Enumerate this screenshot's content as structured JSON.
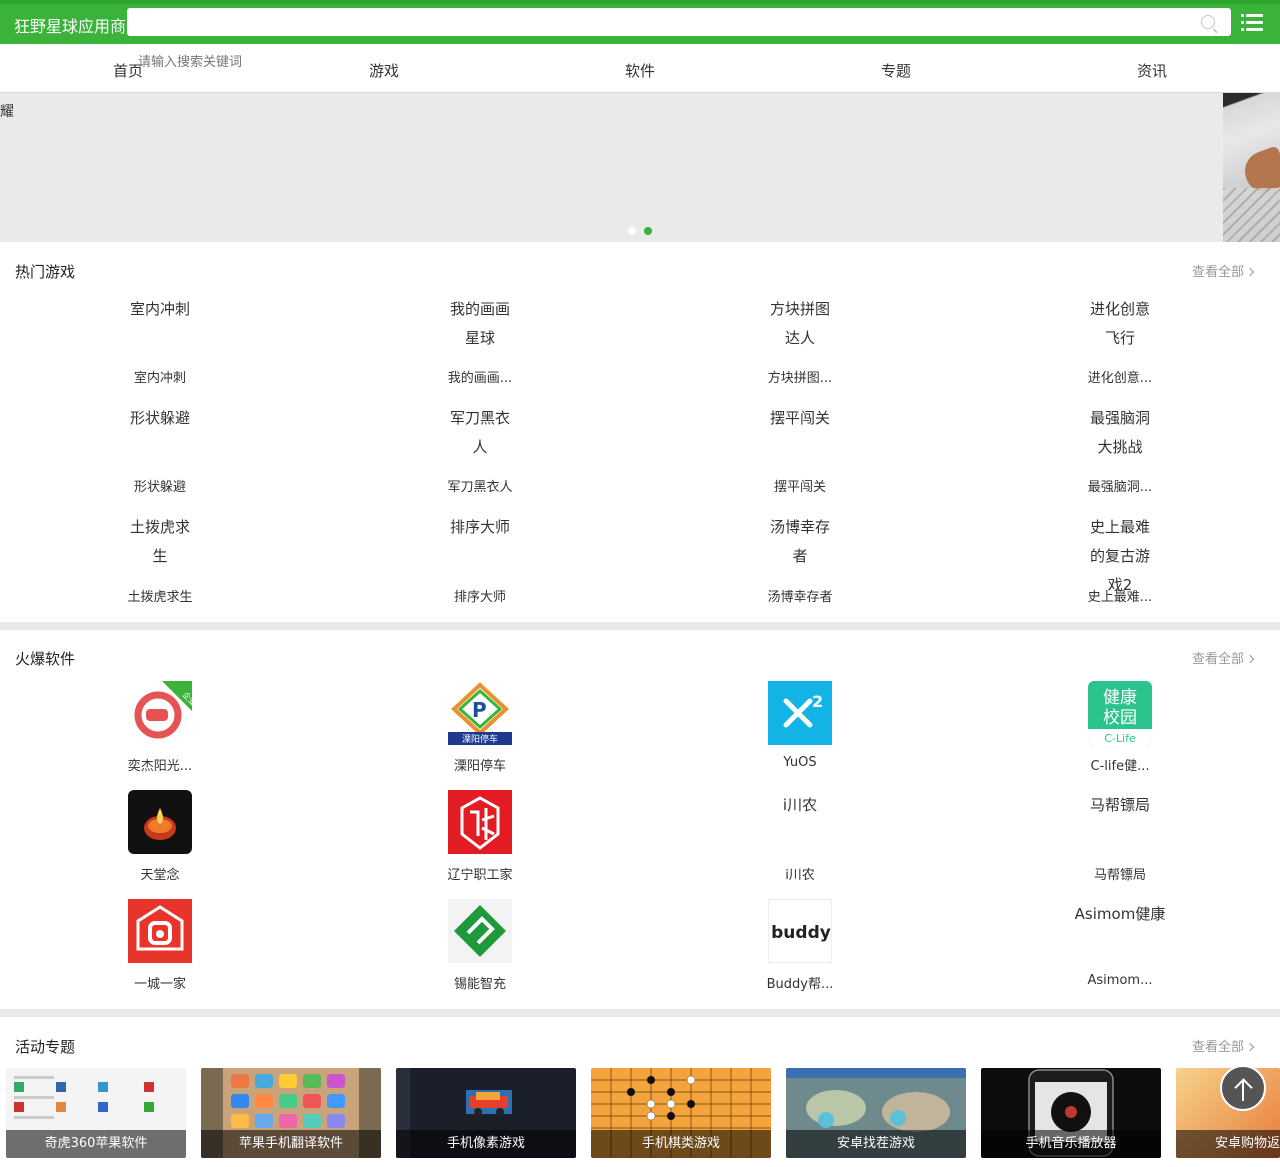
{
  "header": {
    "site_name": "狂野星球应用商",
    "search_placeholder": "请输入搜索关键词"
  },
  "nav": {
    "items": [
      "首页",
      "游戏",
      "软件",
      "专题",
      "资讯"
    ]
  },
  "banner": {
    "left_glyph": "耀",
    "active_dot": 2,
    "dot_count": 2
  },
  "hot_games": {
    "title": "热门游戏",
    "view_all": "查看全部",
    "items": [
      {
        "icon_alt": "室内冲刺",
        "name": "室内冲刺"
      },
      {
        "icon_alt": "我的画画星球",
        "name": "我的画画..."
      },
      {
        "icon_alt": "方块拼图达人",
        "name": "方块拼图..."
      },
      {
        "icon_alt": "进化创意飞行",
        "name": "进化创意..."
      },
      {
        "icon_alt": "形状躲避",
        "name": "形状躲避"
      },
      {
        "icon_alt": "军刀黑衣人",
        "name": "军刀黑衣人"
      },
      {
        "icon_alt": "摆平闯关",
        "name": "摆平闯关"
      },
      {
        "icon_alt": "最强脑洞大挑战",
        "name": "最强脑洞..."
      },
      {
        "icon_alt": "土拨虎求生",
        "name": "土拨虎求生"
      },
      {
        "icon_alt": "排序大师",
        "name": "排序大师"
      },
      {
        "icon_alt": "汤博幸存者",
        "name": "汤博幸存者"
      },
      {
        "icon_alt": "史上最难的复古游戏2",
        "name": "史上最难..."
      }
    ]
  },
  "hot_software": {
    "title": "火爆软件",
    "view_all": "查看全部",
    "items": [
      {
        "name": "奕杰阳光...",
        "icon": "yijie-icon",
        "badge": "企业版"
      },
      {
        "name": "溧阳停车",
        "icon": "liyang-parking-icon",
        "icon_text": "溧阳停车"
      },
      {
        "name": "YuOS",
        "icon": "yuos-icon"
      },
      {
        "name": "C-life健...",
        "icon": "clife-icon",
        "icon_text_top": "健康",
        "icon_text_mid": "校园",
        "icon_text_bottom": "C-Life"
      },
      {
        "name": "天堂念",
        "icon": "candle-icon"
      },
      {
        "name": "辽宁职工家",
        "icon": "liaoning-icon"
      },
      {
        "name": "i川农",
        "icon_alt": "i川农"
      },
      {
        "name": "马帮镖局",
        "icon_alt": "马帮镖局"
      },
      {
        "name": "一城一家",
        "icon": "yichengyijia-icon"
      },
      {
        "name": "锡能智充",
        "icon": "xineng-icon"
      },
      {
        "name": "Buddy帮...",
        "icon": "buddy-icon",
        "icon_text": "buddy"
      },
      {
        "name": "Asimom...",
        "icon_alt": "Asimom健康"
      }
    ]
  },
  "topics": {
    "title": "活动专题",
    "view_all": "查看全部",
    "items": [
      {
        "caption": "奇虎360苹果软件"
      },
      {
        "caption": "苹果手机翻译软件"
      },
      {
        "caption": "手机像素游戏"
      },
      {
        "caption": "手机棋类游戏"
      },
      {
        "caption": "安卓找茬游戏"
      },
      {
        "caption": "手机音乐播放器"
      },
      {
        "caption": "安卓购物返"
      }
    ]
  },
  "colors": {
    "brand_green": "#3bb33b",
    "section_gap": "#e9e9e9"
  }
}
